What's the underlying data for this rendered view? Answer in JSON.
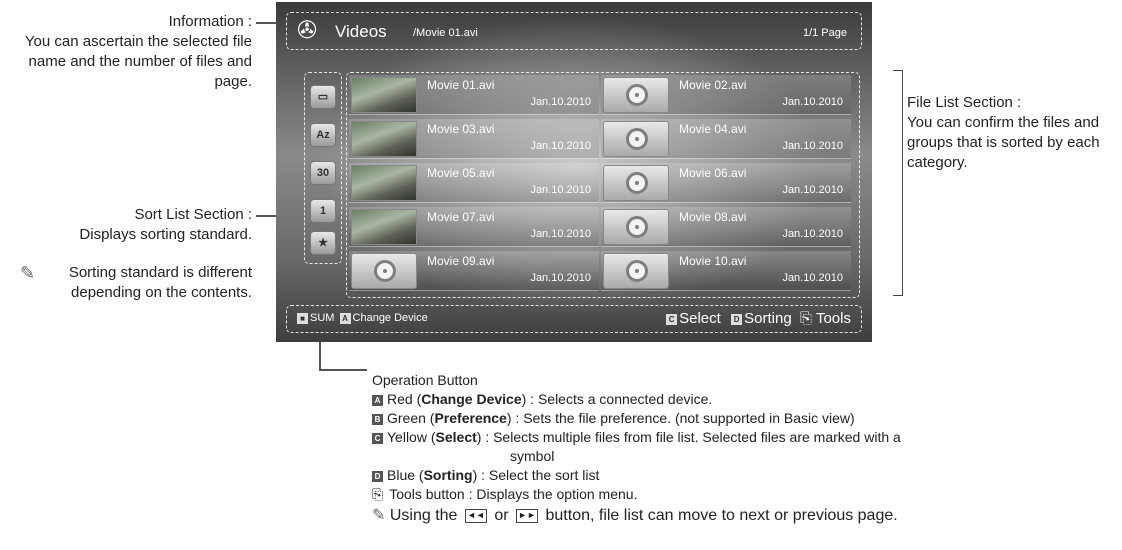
{
  "annotations": {
    "info_title": "Information :",
    "info_desc": "You can ascertain the selected file name and the number of files and page.",
    "sort_title": "Sort List Section :",
    "sort_desc": "Displays sorting standard.",
    "sort_note": "Sorting standard is different depending on the contents.",
    "file_title": "File List Section :",
    "file_desc": "You can confirm the files and groups that is sorted by each category."
  },
  "screen": {
    "app_title": "Videos",
    "path": "/Movie 01.avi",
    "page": "1/1 Page",
    "sort_icons": [
      "folder-icon",
      "az-icon",
      "calendar-30-icon",
      "calendar-1-icon",
      "star-icon"
    ],
    "files": [
      {
        "name": "Movie 01.avi",
        "date": "Jan.10.2010",
        "thumb": "photo"
      },
      {
        "name": "Movie 02.avi",
        "date": "Jan.10.2010",
        "thumb": "reel"
      },
      {
        "name": "Movie 03.avi",
        "date": "Jan.10.2010",
        "thumb": "photo"
      },
      {
        "name": "Movie 04.avi",
        "date": "Jan.10.2010",
        "thumb": "reel"
      },
      {
        "name": "Movie 05.avi",
        "date": "Jan.10.2010",
        "thumb": "photo"
      },
      {
        "name": "Movie 06.avi",
        "date": "Jan.10.2010",
        "thumb": "reel"
      },
      {
        "name": "Movie 07.avi",
        "date": "Jan.10.2010",
        "thumb": "photo"
      },
      {
        "name": "Movie 08.avi",
        "date": "Jan.10.2010",
        "thumb": "reel"
      },
      {
        "name": "Movie 09.avi",
        "date": "Jan.10.2010",
        "thumb": "reel"
      },
      {
        "name": "Movie 10.avi",
        "date": "Jan.10.2010",
        "thumb": "reel"
      }
    ],
    "op_left": "SUM",
    "op_change_key": "A",
    "op_change": "Change Device",
    "op_select_key": "C",
    "op_select": "Select",
    "op_sorting_key": "D",
    "op_sorting": "Sorting",
    "op_tools": "Tools"
  },
  "operation": {
    "heading": "Operation Button",
    "red_key": "A",
    "red_prefix": "Red (",
    "red_name": "Change Device",
    "red_desc": ") : Selects a connected device.",
    "green_key": "B",
    "green_prefix": "Green (",
    "green_name": "Preference",
    "green_desc": ") : Sets the file preference. (not supported in Basic view)",
    "yellow_key": "C",
    "yellow_prefix": "Yellow (",
    "yellow_name": "Select",
    "yellow_desc": ") : Selects multiple files from file list. Selected files are marked with a",
    "yellow_desc2": "symbol",
    "blue_key": "D",
    "blue_prefix": "Blue (",
    "blue_name": "Sorting",
    "blue_desc": ") : Select the sort list",
    "tools_desc": "Tools button : Displays the option menu.",
    "note_a": "Using the",
    "note_b": "or",
    "note_c": "button, file list can move to next or previous page."
  }
}
